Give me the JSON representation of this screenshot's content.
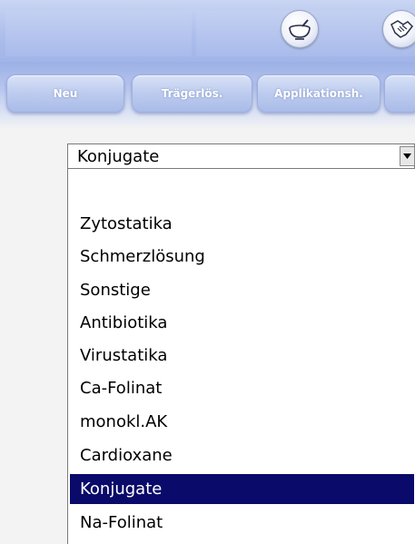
{
  "toolbar": {
    "icons": [
      {
        "name": "mortar-bowl-icon"
      },
      {
        "name": "handshake-icon"
      }
    ]
  },
  "tabs": [
    {
      "label": "Neu"
    },
    {
      "label": "Trägerlös."
    },
    {
      "label": "Applikationsh."
    }
  ],
  "type_select": {
    "value": "Konjugate",
    "options": [
      "",
      "Zytostatika",
      "Schmerzlösung",
      "Sonstige",
      "Antibiotika",
      "Virustatika",
      "Ca-Folinat",
      "monokl.AK",
      "Cardioxane",
      "Konjugate",
      "Na-Folinat"
    ],
    "selected_index": 9
  },
  "colors": {
    "selection": "#0a0a6a",
    "toolbar": "#aebfec"
  }
}
